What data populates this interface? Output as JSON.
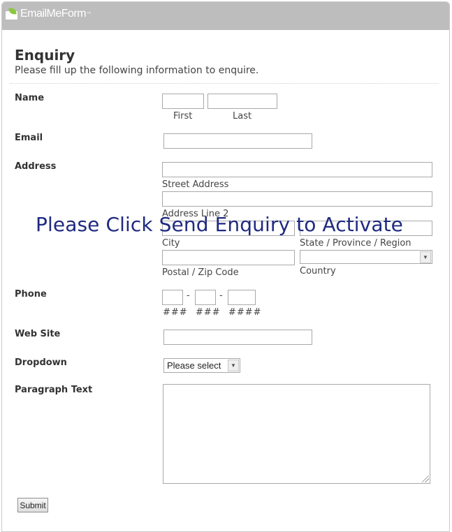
{
  "brand": {
    "logo_text": "EmailMeForm",
    "tm": "™"
  },
  "form": {
    "title": "Enquiry",
    "subtitle": "Please fill up the following information to enquire.",
    "fields": {
      "name": {
        "label": "Name",
        "first_sub": "First",
        "last_sub": "Last"
      },
      "email": {
        "label": "Email"
      },
      "address": {
        "label": "Address",
        "street_sub": "Street Address",
        "line2_sub": "Address Line 2",
        "city_sub": "City",
        "state_sub": "State / Province / Region",
        "postal_sub": "Postal / Zip Code",
        "country_sub": "Country",
        "country_value": ""
      },
      "phone": {
        "label": "Phone",
        "sep": "-",
        "sub1": "###",
        "sub2": "###",
        "sub3": "####"
      },
      "website": {
        "label": "Web Site"
      },
      "dropdown": {
        "label": "Dropdown",
        "value": "Please select"
      },
      "paragraph": {
        "label": "Paragraph Text"
      }
    },
    "overlay_text": "Please Click Send Enquiry to Activate",
    "submit_label": "Submit"
  }
}
